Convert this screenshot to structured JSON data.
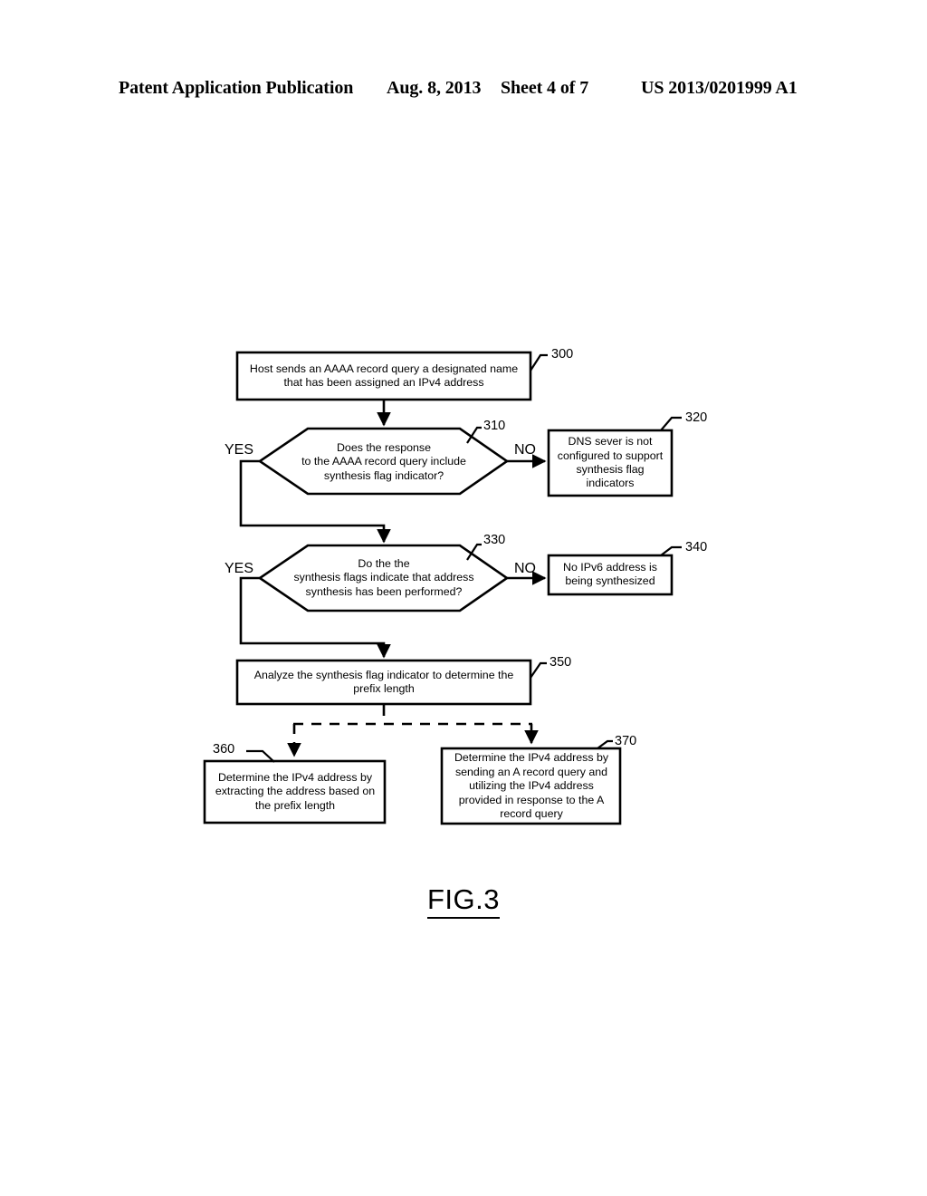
{
  "header": {
    "publication": "Patent Application Publication",
    "date": "Aug. 8, 2013",
    "sheet": "Sheet 4 of 7",
    "patent_number": "US 2013/0201999 A1"
  },
  "figure": {
    "caption": "FIG.3",
    "ink_color": "#000000",
    "background_color": "#ffffff",
    "nodes": {
      "n300": {
        "ref": "300",
        "shape": "rectangle",
        "line1": "Host sends an AAAA record query a designated name",
        "line2": "that has been assigned an IPv4 address"
      },
      "n310": {
        "ref": "310",
        "shape": "hexagon",
        "line1": "Does the response",
        "line2": "to the AAAA record query include",
        "line3": "synthesis flag indicator?"
      },
      "n320": {
        "ref": "320",
        "shape": "rectangle",
        "line1": "DNS sever is not",
        "line2": "configured to support",
        "line3": "synthesis flag",
        "line4": "indicators"
      },
      "n330": {
        "ref": "330",
        "shape": "hexagon",
        "line1": "Do the the",
        "line2": "synthesis flags indicate that address",
        "line3": "synthesis has been performed?"
      },
      "n340": {
        "ref": "340",
        "shape": "rectangle",
        "line1": "No IPv6 address is",
        "line2": "being synthesized"
      },
      "n350": {
        "ref": "350",
        "shape": "rectangle",
        "line1": "Analyze the synthesis flag indicator to determine the",
        "line2": "prefix length"
      },
      "n360": {
        "ref": "360",
        "shape": "rectangle",
        "line1": "Determine the IPv4 address by",
        "line2": "extracting the address based on",
        "line3": "the prefix length"
      },
      "n370": {
        "ref": "370",
        "shape": "rectangle",
        "line1": "Determine the IPv4 address by",
        "line2": "sending an A record query and",
        "line3": "utilizing the IPv4 address",
        "line4": "provided in response to the A",
        "line5": "record query"
      }
    },
    "branches": {
      "yes_310": "YES",
      "no_310": "NO",
      "yes_330": "YES",
      "no_330": "NO"
    }
  }
}
